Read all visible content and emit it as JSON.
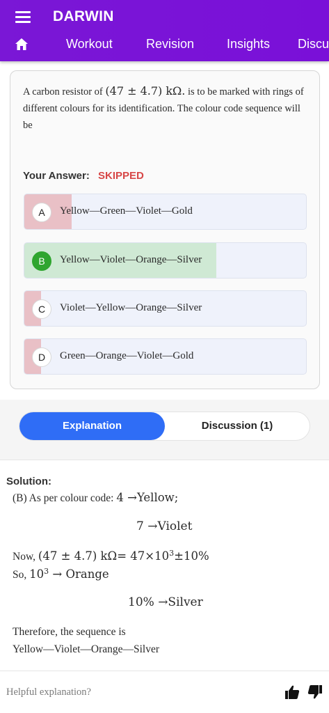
{
  "header": {
    "title": "DARWIN",
    "nav_tabs": [
      "Workout",
      "Revision",
      "Insights",
      "Discu"
    ]
  },
  "question": {
    "text_before": "A carbon resistor of",
    "value_math": "(47 ± 4.7) kΩ.",
    "text_after": "is to be marked with rings of different colours for its identification. The colour code sequence will be"
  },
  "answer": {
    "label": "Your Answer:",
    "value": "SKIPPED"
  },
  "options": [
    {
      "letter": "A",
      "text": "Yellow—Green—Violet—Gold"
    },
    {
      "letter": "B",
      "text": "Yellow—Violet—Orange—Silver"
    },
    {
      "letter": "C",
      "text": "Violet—Yellow—Orange—Silver"
    },
    {
      "letter": "D",
      "text": "Green—Orange—Violet—Gold"
    }
  ],
  "tabs": {
    "explanation": "Explanation",
    "discussion": "Discussion (1)"
  },
  "solution": {
    "heading": "Solution:",
    "line1_text": "(B) As per colour code: ",
    "line1_math": "4 →Yellow;",
    "line2_math": "7 →Violet",
    "line3_text": "Now, ",
    "line3_math_a": "(47 ± 4.7) kΩ= 47×10",
    "line3_sup": "3",
    "line3_math_b": "±10%",
    "line4_text": "So, ",
    "line4_math_a": "10",
    "line4_sup": "3",
    "line4_math_b": " → Orange",
    "line5_math": "10% →Silver",
    "line6_text": "Therefore, the sequence is",
    "line7_text": "Yellow—Violet—Orange—Silver"
  },
  "feedback": {
    "prompt": "Helpful explanation?"
  },
  "colors": {
    "header_bg": "#7a10d8",
    "skipped": "#d74747",
    "correct_green": "#2fa52f",
    "tab_active": "#2f6df6"
  }
}
